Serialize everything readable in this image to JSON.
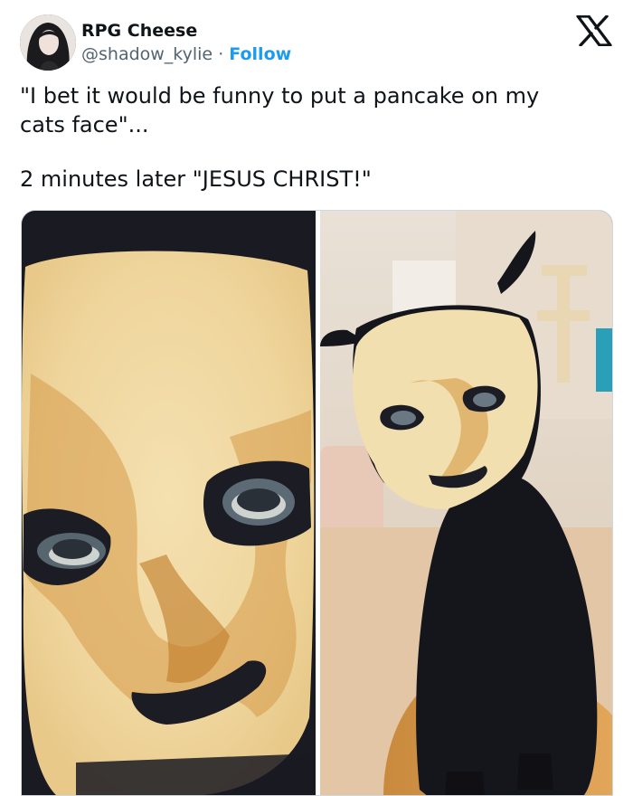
{
  "author": {
    "display_name": "RPG Cheese",
    "handle": "@shadow_kylie",
    "separator": "·",
    "follow_label": "Follow",
    "avatar_icon": "avatar-portrait"
  },
  "platform": {
    "logo_icon": "x-logo-icon"
  },
  "tweet": {
    "line_1": "\"I bet it would be funny to put a pancake on my",
    "line_2": "cats face\"...",
    "line_3": "2 minutes later \"JESUS CHRIST!\""
  },
  "media": {
    "photo_count": 2,
    "photos": [
      {
        "icon": "pancake-masked-cat-closeup-photo"
      },
      {
        "icon": "pancake-masked-black-cat-on-chair-photo"
      }
    ]
  },
  "colors": {
    "text": "#0f1419",
    "secondary_text": "#536471",
    "follow_blue": "#1d9bf0",
    "border": "#cfd9de",
    "pancake": "#f1d9a3",
    "pancake_browned": "#c9872e",
    "cat_black": "#15151c"
  }
}
